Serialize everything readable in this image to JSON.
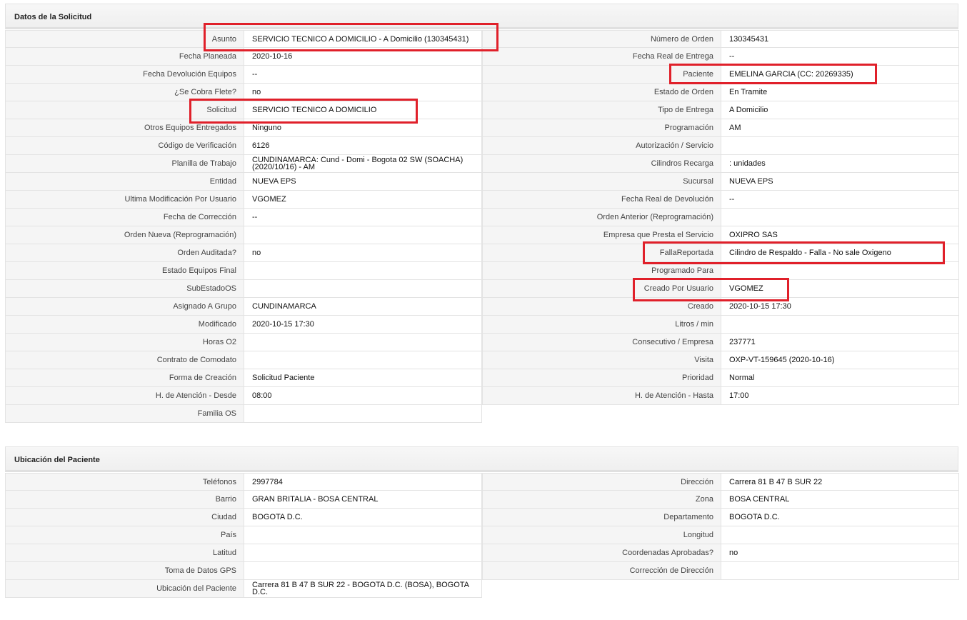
{
  "solicitud": {
    "title": "Datos de la Solicitud",
    "left": [
      {
        "label": "Asunto",
        "value": "SERVICIO TECNICO A DOMICILIO - A Domicilio (130345431)"
      },
      {
        "label": "Fecha Planeada",
        "value": " 2020-10-16"
      },
      {
        "label": "Fecha Devolución Equipos",
        "value": "--"
      },
      {
        "label": "¿Se Cobra Flete?",
        "value": " no"
      },
      {
        "label": "Solicitud",
        "value": "SERVICIO TECNICO A DOMICILIO"
      },
      {
        "label": "Otros Equipos Entregados",
        "value": "Ninguno"
      },
      {
        "label": "Código de Verificación",
        "value": "6126"
      },
      {
        "label": "Planilla de Trabajo",
        "value": "CUNDINAMARCA: Cund - Domi - Bogota 02 SW (SOACHA) (2020/10/16) - AM"
      },
      {
        "label": "Entidad",
        "value": "NUEVA EPS"
      },
      {
        "label": "Ultima Modificación Por Usuario",
        "value": "VGOMEZ"
      },
      {
        "label": "Fecha de Corrección",
        "value": "--"
      },
      {
        "label": "Orden Nueva (Reprogramación)",
        "value": ""
      },
      {
        "label": "Orden Auditada?",
        "value": " no"
      },
      {
        "label": "Estado Equipos Final",
        "value": ""
      },
      {
        "label": "SubEstadoOS",
        "value": ""
      },
      {
        "label": "Asignado A Grupo",
        "value": "CUNDINAMARCA"
      },
      {
        "label": "Modificado",
        "value": "2020-10-15 17:30"
      },
      {
        "label": "Horas O2",
        "value": ""
      },
      {
        "label": "Contrato de Comodato",
        "value": ""
      },
      {
        "label": "Forma de Creación",
        "value": "Solicitud Paciente"
      },
      {
        "label": "H. de Atención - Desde",
        "value": "08:00"
      },
      {
        "label": "Familia OS",
        "value": ""
      }
    ],
    "right": [
      {
        "label": "Número de Orden",
        "value": "130345431"
      },
      {
        "label": "Fecha Real de Entrega",
        "value": "--"
      },
      {
        "label": "Paciente",
        "value": "EMELINA GARCIA (CC: 20269335)"
      },
      {
        "label": "Estado de Orden",
        "value": "En Tramite"
      },
      {
        "label": "Tipo de Entrega",
        "value": "A Domicilio"
      },
      {
        "label": "Programación",
        "value": "AM"
      },
      {
        "label": "Autorización / Servicio",
        "value": ""
      },
      {
        "label": "Cilindros Recarga",
        "value": ": unidades"
      },
      {
        "label": "Sucursal",
        "value": "NUEVA EPS"
      },
      {
        "label": "Fecha Real de Devolución",
        "value": "--"
      },
      {
        "label": "Orden Anterior (Reprogramación)",
        "value": ""
      },
      {
        "label": "Empresa que Presta el Servicio",
        "value": "OXIPRO SAS"
      },
      {
        "label": "FallaReportada",
        "value": "Cilindro de Respaldo - Falla - No sale Oxigeno"
      },
      {
        "label": "Programado Para",
        "value": ""
      },
      {
        "label": "Creado Por Usuario",
        "value": "VGOMEZ"
      },
      {
        "label": "Creado",
        "value": "2020-10-15 17:30"
      },
      {
        "label": "Litros / min",
        "value": ""
      },
      {
        "label": "Consecutivo / Empresa",
        "value": "237771"
      },
      {
        "label": "Visita",
        "value": "OXP-VT-159645 (2020-10-16)"
      },
      {
        "label": "Prioridad",
        "value": "Normal"
      },
      {
        "label": "H. de Atención - Hasta",
        "value": "17:00"
      }
    ]
  },
  "ubicacion": {
    "title": "Ubicación del Paciente",
    "left": [
      {
        "label": "Teléfonos",
        "value": "2997784"
      },
      {
        "label": "Barrio",
        "value": "GRAN BRITALIA - BOSA CENTRAL"
      },
      {
        "label": "Ciudad",
        "value": "BOGOTA D.C."
      },
      {
        "label": "País",
        "value": ""
      },
      {
        "label": "Latitud",
        "value": ""
      },
      {
        "label": "Toma de Datos GPS",
        "value": ""
      },
      {
        "label": "Ubicación del Paciente",
        "value": "Carrera 81 B 47 B SUR 22 - BOGOTA D.C. (BOSA), BOGOTA D.C."
      }
    ],
    "right": [
      {
        "label": "Dirección",
        "value": "Carrera 81 B 47 B SUR 22"
      },
      {
        "label": "Zona",
        "value": "BOSA CENTRAL"
      },
      {
        "label": "Departamento",
        "value": "BOGOTA D.C."
      },
      {
        "label": "Longitud",
        "value": ""
      },
      {
        "label": "Coordenadas Aprobadas?",
        "value": " no"
      },
      {
        "label": "Corrección de Dirección",
        "value": ""
      }
    ]
  },
  "highlight_color": "#e0202a"
}
